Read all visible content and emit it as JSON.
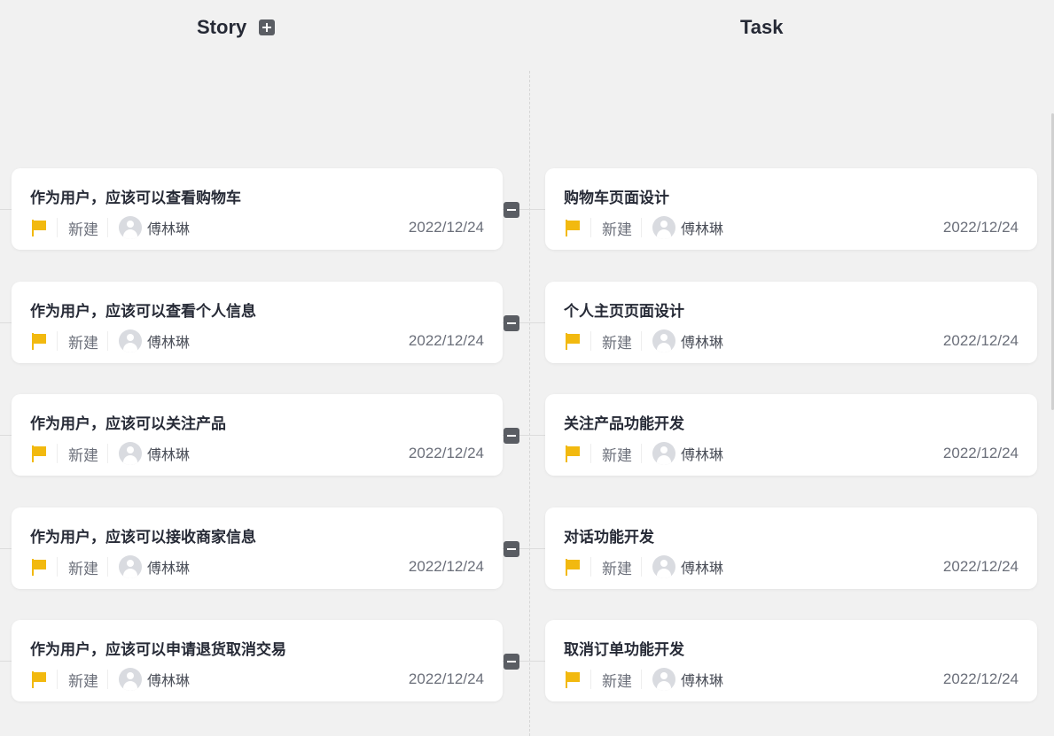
{
  "columns": {
    "story": "Story",
    "task": "Task"
  },
  "rows": [
    {
      "story": {
        "title": "作为用户，应该可以查看购物车",
        "status": "新建",
        "assignee": "傅林琳",
        "date": "2022/12/24"
      },
      "task": {
        "title": "购物车页面设计",
        "status": "新建",
        "assignee": "傅林琳",
        "date": "2022/12/24"
      }
    },
    {
      "story": {
        "title": "作为用户，应该可以查看个人信息",
        "status": "新建",
        "assignee": "傅林琳",
        "date": "2022/12/24"
      },
      "task": {
        "title": "个人主页页面设计",
        "status": "新建",
        "assignee": "傅林琳",
        "date": "2022/12/24"
      }
    },
    {
      "story": {
        "title": "作为用户，应该可以关注产品",
        "status": "新建",
        "assignee": "傅林琳",
        "date": "2022/12/24"
      },
      "task": {
        "title": "关注产品功能开发",
        "status": "新建",
        "assignee": "傅林琳",
        "date": "2022/12/24"
      }
    },
    {
      "story": {
        "title": "作为用户，应该可以接收商家信息",
        "status": "新建",
        "assignee": "傅林琳",
        "date": "2022/12/24"
      },
      "task": {
        "title": "对话功能开发",
        "status": "新建",
        "assignee": "傅林琳",
        "date": "2022/12/24"
      }
    },
    {
      "story": {
        "title": "作为用户，应该可以申请退货取消交易",
        "status": "新建",
        "assignee": "傅林琳",
        "date": "2022/12/24"
      },
      "task": {
        "title": "取消订单功能开发",
        "status": "新建",
        "assignee": "傅林琳",
        "date": "2022/12/24"
      }
    }
  ],
  "icons": {
    "add": "plus-square-icon",
    "collapse": "minus-square-icon",
    "priority": "flag-icon",
    "avatar": "user-avatar-icon"
  },
  "colors": {
    "background": "#f1f1f1",
    "card": "#ffffff",
    "flag": "#f2b90f",
    "button": "#5a5d63"
  }
}
